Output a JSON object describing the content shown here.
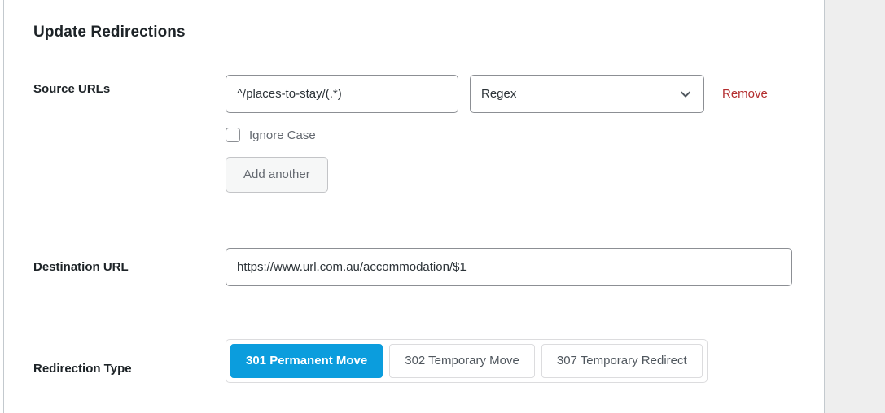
{
  "panel": {
    "title": "Update Redirections"
  },
  "source": {
    "label": "Source URLs",
    "url_value": "^/places-to-stay/(.*)",
    "url_placeholder": "",
    "match_type": "Regex",
    "match_type_options": [
      "Regex"
    ],
    "chevron_icon": "chevron-down-icon",
    "remove_label": "Remove",
    "ignore_case_label": "Ignore Case",
    "ignore_case_checked": false,
    "add_another_label": "Add another"
  },
  "destination": {
    "label": "Destination URL",
    "value": "https://www.url.com.au/accommodation/$1",
    "placeholder": ""
  },
  "redirection_type": {
    "label": "Redirection Type",
    "options": [
      {
        "label": "301 Permanent Move",
        "active": true
      },
      {
        "label": "302 Temporary Move",
        "active": false
      },
      {
        "label": "307 Temporary Redirect",
        "active": false
      }
    ]
  },
  "colors": {
    "accent_blue": "#0b9ddd",
    "remove_red": "#b32d2e",
    "label_text": "#1d2327",
    "muted_text": "#646970",
    "gutter_gray": "#eeeeee"
  }
}
